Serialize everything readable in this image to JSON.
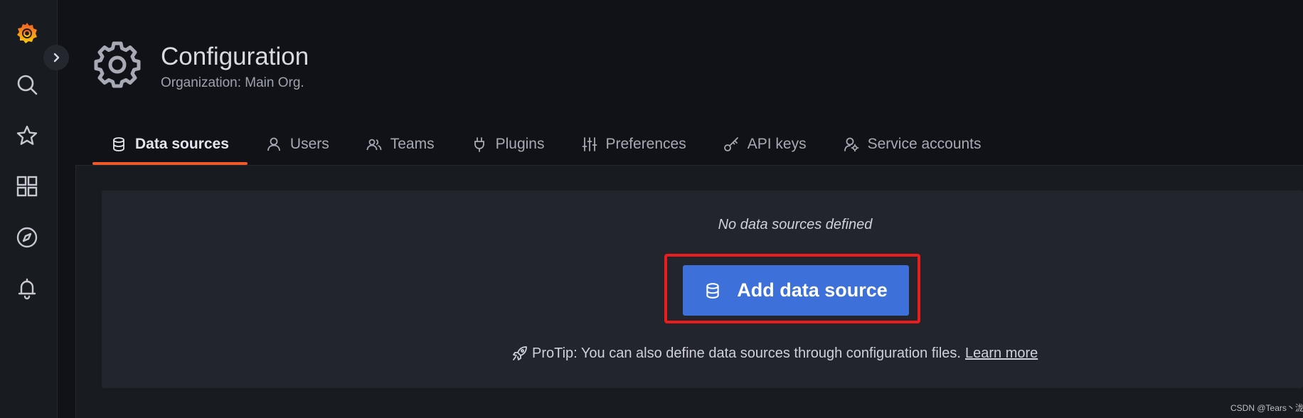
{
  "sidebar": {
    "icons": [
      "grafana-logo-icon",
      "search-icon",
      "star-icon",
      "dashboards-icon",
      "explore-compass-icon",
      "alerting-bell-icon"
    ]
  },
  "header": {
    "title": "Configuration",
    "subtitle": "Organization: Main Org.",
    "icon": "gear-icon"
  },
  "tabs": [
    {
      "label": "Data sources",
      "icon": "database-icon",
      "active": true
    },
    {
      "label": "Users",
      "icon": "user-icon",
      "active": false
    },
    {
      "label": "Teams",
      "icon": "users-icon",
      "active": false
    },
    {
      "label": "Plugins",
      "icon": "plug-icon",
      "active": false
    },
    {
      "label": "Preferences",
      "icon": "sliders-icon",
      "active": false
    },
    {
      "label": "API keys",
      "icon": "key-icon",
      "active": false
    },
    {
      "label": "Service accounts",
      "icon": "user-cog-icon",
      "active": false
    }
  ],
  "empty_state": {
    "message": "No data sources defined",
    "button_label": "Add data source",
    "protip_text": "ProTip: You can also define data sources through configuration files.",
    "learn_more_label": "Learn more"
  },
  "watermark": "CSDN @Tears丶泷",
  "colors": {
    "accent_tab": "#f05a28",
    "primary_button": "#3d71d9",
    "highlight_box": "#ea1c1c",
    "background": "#111217",
    "panel": "#22252b"
  }
}
